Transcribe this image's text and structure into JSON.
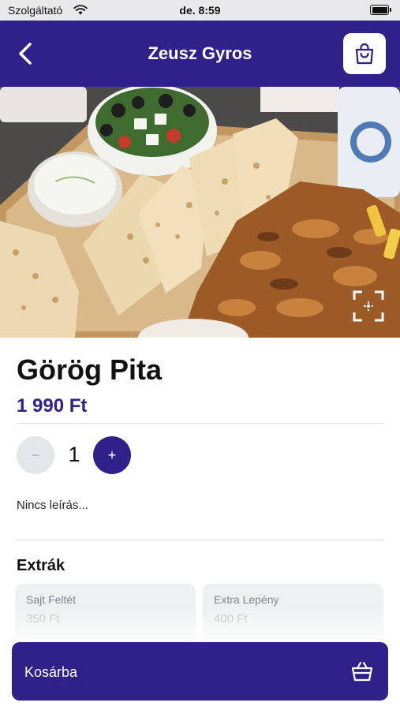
{
  "status_bar": {
    "carrier": "Szolgáltató",
    "time": "de. 8:59"
  },
  "header": {
    "title": "Zeusz Gyros",
    "back_icon": "chevron-left-icon",
    "cart_icon": "shopping-bag-icon"
  },
  "hero": {
    "expand_icon": "fullscreen-icon"
  },
  "product": {
    "name": "Görög Pita",
    "price": "1 990 Ft",
    "quantity": "1",
    "minus_label": "−",
    "plus_label": "+",
    "description": "Nincs leírás..."
  },
  "extras": {
    "heading": "Extrák",
    "items": [
      {
        "name": "Sajt Feltét",
        "price": "350 Ft"
      },
      {
        "name": "Extra Lepény",
        "price": "400 Ft"
      }
    ]
  },
  "footer": {
    "cart_label": "Kosárba",
    "cart_icon": "basket-icon"
  },
  "colors": {
    "brand": "#30208a",
    "price": "#30208a",
    "minus_bg": "#e3e7ea",
    "card_bg": "#eef0f2"
  }
}
